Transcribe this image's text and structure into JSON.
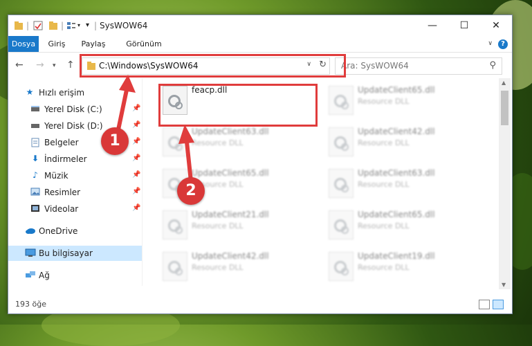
{
  "window": {
    "title": "SysWOW64",
    "controls": {
      "minimize": "—",
      "maximize": "☐",
      "close": "✕"
    }
  },
  "ribbon": {
    "tabs": [
      {
        "label": "Dosya",
        "active": true
      },
      {
        "label": "Giriş",
        "active": false
      },
      {
        "label": "Paylaş",
        "active": false
      },
      {
        "label": "Görünüm",
        "active": false
      }
    ],
    "help": "?"
  },
  "navigation": {
    "back": "←",
    "forward": "→",
    "up": "↑",
    "address": "C:\\Windows\\SysWOW64",
    "search_placeholder": "Ara: SysWOW64"
  },
  "sidebar": {
    "items": [
      {
        "label": "Hızlı erişim",
        "icon": "star-icon",
        "pinned": false
      },
      {
        "label": "Yerel Disk (C:)",
        "icon": "drive-icon",
        "pinned": true
      },
      {
        "label": "Yerel Disk (D:)",
        "icon": "drive-icon",
        "pinned": true
      },
      {
        "label": "Belgeler",
        "icon": "document-icon",
        "pinned": true
      },
      {
        "label": "İndirmeler",
        "icon": "download-icon",
        "pinned": true
      },
      {
        "label": "Müzik",
        "icon": "music-icon",
        "pinned": true
      },
      {
        "label": "Resimler",
        "icon": "pictures-icon",
        "pinned": true
      },
      {
        "label": "Videolar",
        "icon": "video-icon",
        "pinned": true
      },
      {
        "label": "OneDrive",
        "icon": "cloud-icon",
        "pinned": false
      },
      {
        "label": "Bu bilgisayar",
        "icon": "computer-icon",
        "pinned": false,
        "selected": true
      },
      {
        "label": "Ağ",
        "icon": "network-icon",
        "pinned": false
      }
    ]
  },
  "files": [
    {
      "name": "feacp.dll",
      "type": "",
      "highlighted": true
    },
    {
      "name": "UpdateClient65.dll",
      "type": "Resource DLL"
    },
    {
      "name": "UpdateClient63.dll",
      "type": "Resource DLL"
    },
    {
      "name": "UpdateClient42.dll",
      "type": "Resource DLL"
    },
    {
      "name": "UpdateClient65.dll",
      "type": "Resource DLL"
    },
    {
      "name": "UpdateClient63.dll",
      "type": "Resource DLL"
    },
    {
      "name": "UpdateClient21.dll",
      "type": "Resource DLL"
    },
    {
      "name": "UpdateClient65.dll",
      "type": "Resource DLL"
    },
    {
      "name": "UpdateClient42.dll",
      "type": "Resource DLL"
    },
    {
      "name": "UpdateClient19.dll",
      "type": "Resource DLL"
    }
  ],
  "status": {
    "item_count": "193 öğe"
  },
  "annotations": {
    "step1": "1",
    "step2": "2"
  },
  "colors": {
    "accent": "#1979ca",
    "annotation_red": "#e03c3c",
    "selected_bg": "#cce8ff"
  }
}
